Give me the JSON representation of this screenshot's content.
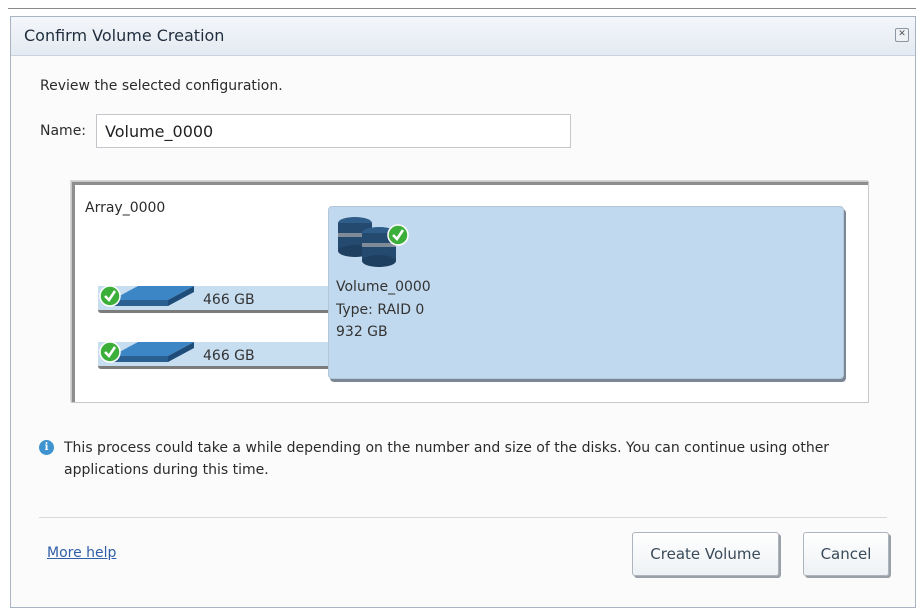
{
  "dialog": {
    "title": "Confirm Volume Creation",
    "close_icon": "close-icon",
    "review_text": "Review the selected configuration.",
    "name_label": "Name:",
    "name_value": "Volume_0000"
  },
  "array": {
    "name": "Array_0000",
    "disks": [
      {
        "size": "466 GB",
        "icon": "disk-ok-icon"
      },
      {
        "size": "466 GB",
        "icon": "disk-ok-icon"
      }
    ],
    "volume": {
      "name": "Volume_0000",
      "type": "Type: RAID 0",
      "size": "932 GB",
      "icon": "volume-ok-icon"
    }
  },
  "info": {
    "icon": "info-icon",
    "text": "This process could take a while depending on the number and size of the disks. You can continue using other applications during this time."
  },
  "footer": {
    "more_help": "More help",
    "create_button": "Create Volume",
    "cancel_button": "Cancel"
  },
  "colors": {
    "accent": "#c1d9ee",
    "link": "#2f5fa8",
    "check": "#3cae3a"
  }
}
